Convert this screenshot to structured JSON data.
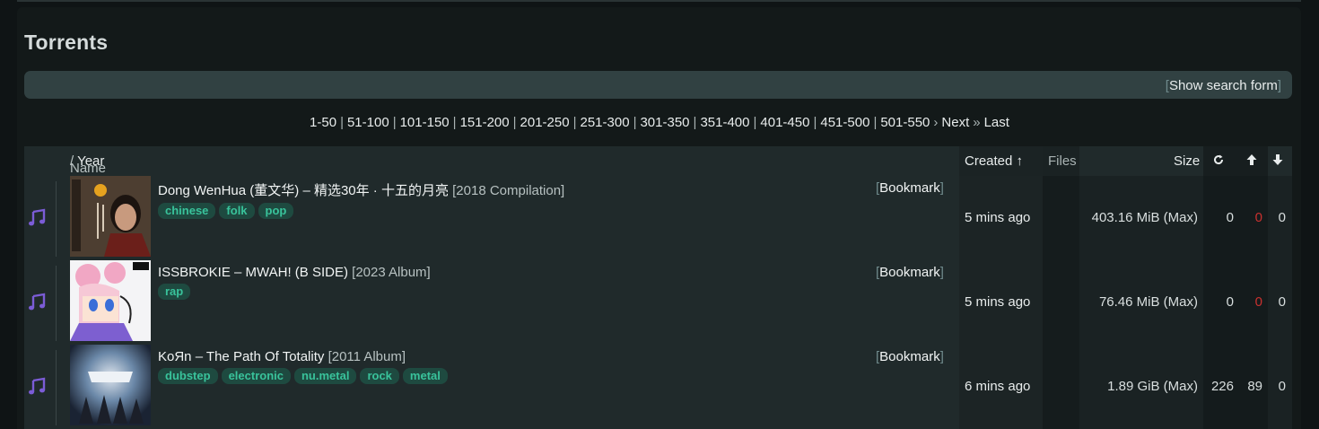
{
  "page": {
    "title": "Torrents"
  },
  "search": {
    "toggle_label": "Show search form"
  },
  "pagination": {
    "pages": [
      "1-50",
      "51-100",
      "101-150",
      "151-200",
      "201-250",
      "251-300",
      "301-350",
      "351-400",
      "401-450",
      "451-500",
      "501-550"
    ],
    "next_label": "Next",
    "last_label": "Last"
  },
  "table": {
    "headers": {
      "name": "Name",
      "year": "Year",
      "created": "Created ↑",
      "files": "Files",
      "size": "Size"
    },
    "bookmark_label": "Bookmark",
    "rows": [
      {
        "title": "Dong WenHua (董文华) – 精选30年 · 十五的月亮",
        "year_info": "[2018 Compilation]",
        "tags": [
          "chinese",
          "folk",
          "pop"
        ],
        "created": "5 mins ago",
        "size": "403.16 MiB (Max)",
        "snatched": "0",
        "seeders": "0",
        "leechers": "0"
      },
      {
        "title": "ISSBROKIE – MWAH! (B SIDE)",
        "year_info": "[2023 Album]",
        "tags": [
          "rap"
        ],
        "created": "5 mins ago",
        "size": "76.46 MiB (Max)",
        "snatched": "0",
        "seeders": "0",
        "leechers": "0"
      },
      {
        "title": "KoЯn – The Path Of Totality",
        "year_info": "[2011 Album]",
        "tags": [
          "dubstep",
          "electronic",
          "nu.metal",
          "rock",
          "metal"
        ],
        "created": "6 mins ago",
        "size": "1.89 GiB (Max)",
        "snatched": "226",
        "seeders": "89",
        "leechers": "0"
      }
    ]
  },
  "colors": {
    "accent_tag": "#39c39b",
    "tag_bg": "#1e4a40",
    "zero_seeders": "#c8312f",
    "music_icon": "#7b5cd6"
  }
}
